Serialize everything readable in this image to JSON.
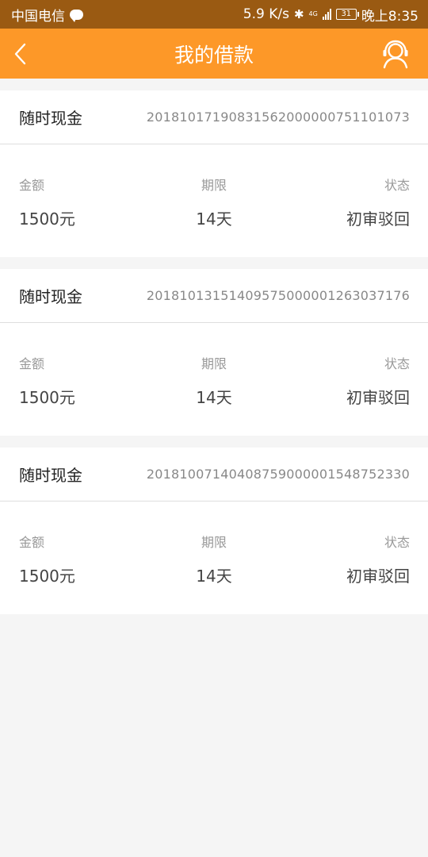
{
  "status_bar": {
    "carrier": "中国电信",
    "net_speed": "5.9 K/s",
    "network": "4G",
    "battery": "31",
    "time": "晚上8:35"
  },
  "nav": {
    "title": "我的借款",
    "back_icon": "chevron-left-icon",
    "service_icon": "customer-service-icon"
  },
  "labels": {
    "amount": "金额",
    "term": "期限",
    "status": "状态"
  },
  "loans": [
    {
      "product": "随时现金",
      "order_no": "20181017190831562000000751101073",
      "amount": "1500元",
      "term": "14天",
      "status": "初审驳回"
    },
    {
      "product": "随时现金",
      "order_no": "20181013151409575000001263037176",
      "amount": "1500元",
      "term": "14天",
      "status": "初审驳回"
    },
    {
      "product": "随时现金",
      "order_no": "20181007140408759000001548752330",
      "amount": "1500元",
      "term": "14天",
      "status": "初审驳回"
    }
  ],
  "colors": {
    "status_bar": "#9a5a12",
    "nav_bar": "#fd9828",
    "background": "#f5f5f5"
  }
}
